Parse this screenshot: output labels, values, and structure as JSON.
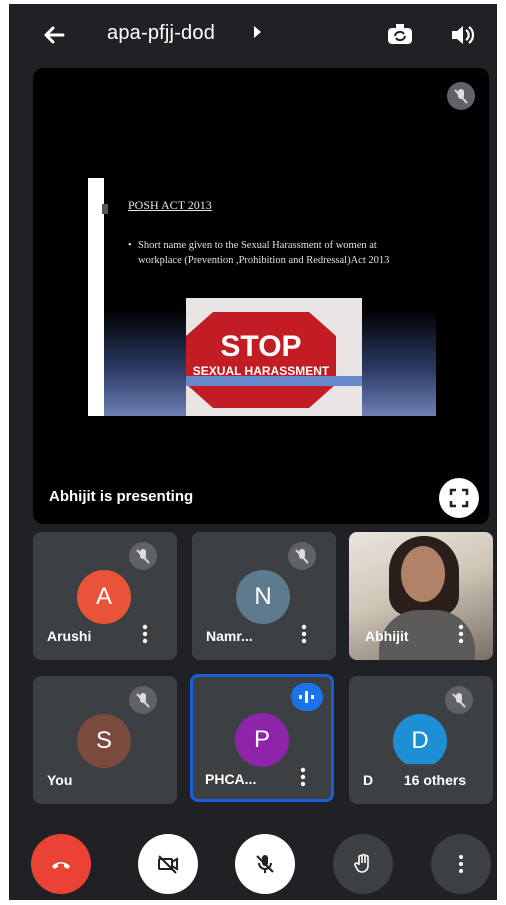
{
  "top_bar": {
    "meeting_code": "apa-pfjj-dod",
    "icons": [
      "back-arrow-icon",
      "switch-camera-icon",
      "speaker-icon"
    ]
  },
  "presentation": {
    "presenting_label": "Abhijit is presenting",
    "slide": {
      "title": "POSH ACT 2013",
      "bullet": "Short name given to the Sexual Harassment of women at workplace (Prevention ,Prohibition and Redressal)Act 2013",
      "image_text": "STOP",
      "image_subtext": "SEXUAL HARASSMENT"
    }
  },
  "participants": [
    {
      "initial": "A",
      "name": "Arushi",
      "avatar_color": "#e8533a",
      "muted": true
    },
    {
      "initial": "N",
      "name": "Namr...",
      "avatar_color": "#5d7b8c",
      "muted": true
    },
    {
      "initial": "",
      "name": "Abhijit",
      "video": true,
      "muted": false
    },
    {
      "initial": "S",
      "name": "You",
      "avatar_color": "#7a4a3f",
      "muted": true
    },
    {
      "initial": "P",
      "name": "PHCA...",
      "avatar_color": "#8e24aa",
      "speaking": true
    },
    {
      "initial": "D",
      "name": "D",
      "avatar_color": "#1e8fd5",
      "muted": true,
      "others_label": "16 others"
    }
  ],
  "controls": {
    "end_call_color": "#ea4335",
    "buttons": [
      "end-call",
      "camera-off",
      "mic-off",
      "raise-hand",
      "more-options"
    ]
  }
}
